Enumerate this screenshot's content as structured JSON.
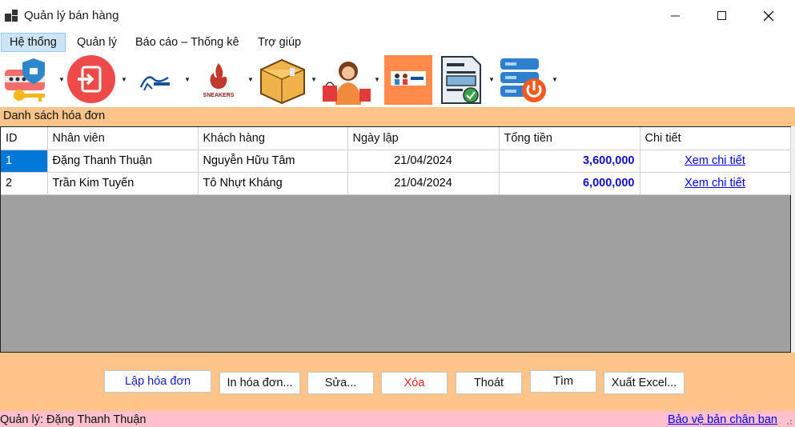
{
  "window": {
    "title": "Quản lý bán hàng"
  },
  "menu": [
    "Hệ thống",
    "Quản lý",
    "Báo cáo – Thống kê",
    "Trợ giúp"
  ],
  "toolbar": {
    "tools": [
      "login-security-icon",
      "logout-icon",
      "brand-logo-icon",
      "sneakers-logo-icon",
      "box-icon",
      "shopper-icon",
      "customers-icon",
      "invoice-icon",
      "server-power-icon"
    ],
    "sneakers_text": "SNEAKERS"
  },
  "section": {
    "title": "Danh sách hóa đơn"
  },
  "grid": {
    "columns": [
      "ID",
      "Nhân viên",
      "Khách hàng",
      "Ngày lập",
      "Tổng tiền",
      "Chi tiết"
    ],
    "rows": [
      {
        "id": "1",
        "nhan_vien": "Đặng Thanh Thuận",
        "khach_hang": "Nguyễn Hữu Tâm",
        "ngay_lap": "21/04/2024",
        "tong_tien": "3,600,000",
        "chi_tiet": "Xem chi tiết"
      },
      {
        "id": "2",
        "nhan_vien": "Trần Kim Tuyến",
        "khach_hang": "Tô Nhựt Kháng",
        "ngay_lap": "21/04/2024",
        "tong_tien": "6,000,000",
        "chi_tiet": "Xem chi tiết"
      }
    ]
  },
  "buttons": {
    "lap_hoa_don": "Lập hóa đơn",
    "in_hoa_don": "In hóa đơn...",
    "sua": "Sửa...",
    "xoa": "Xóa",
    "thoat": "Thoát",
    "tim": "Tìm",
    "xuat_excel": "Xuất Excel..."
  },
  "status": {
    "left": "Quản lý: Đặng Thanh Thuận",
    "right": "Bảo vệ bản chân ban"
  },
  "colors": {
    "panel": "#ffc48a",
    "status": "#ffc0cb",
    "selection": "#0078d7",
    "money": "#1010c8"
  }
}
